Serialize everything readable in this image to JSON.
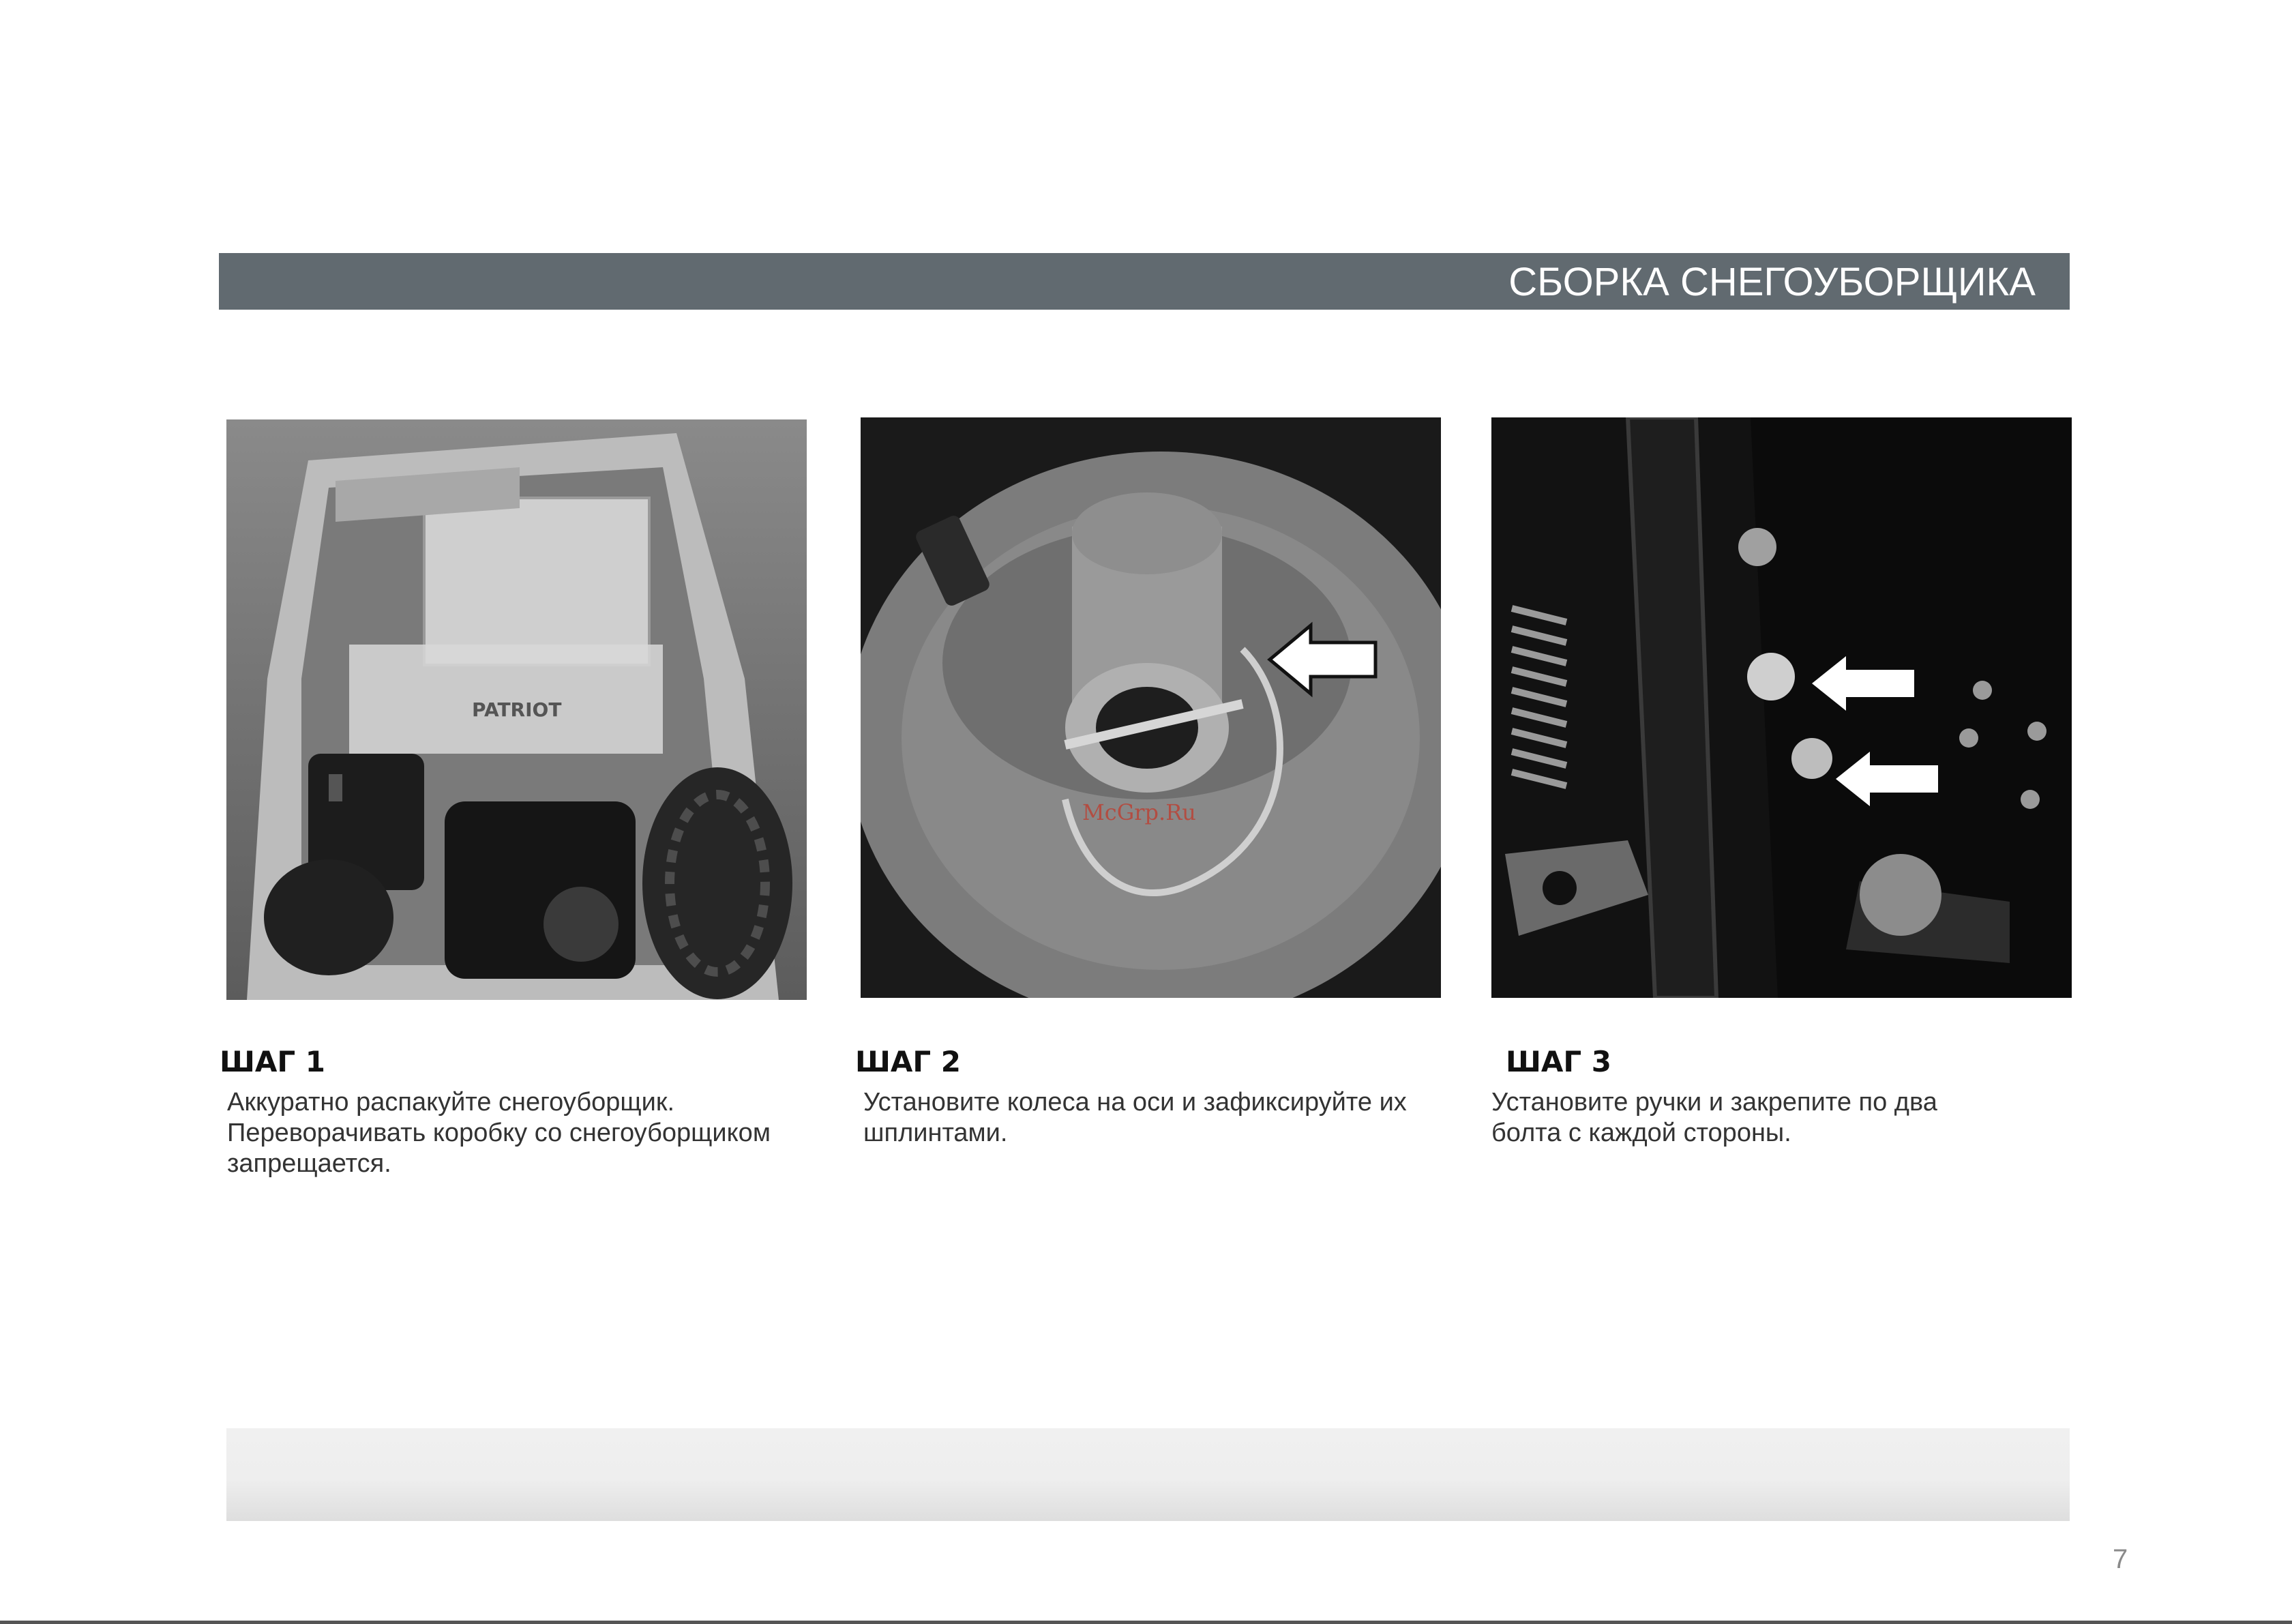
{
  "header": {
    "title": "СБОРКА СНЕГОУБОРЩИКА"
  },
  "steps": [
    {
      "title": "ШАГ 1",
      "lines": [
        "Аккуратно распакуйте снегоуборщик.",
        "Переворачивать коробку со снегоуборщиком",
        "запрещается."
      ],
      "photo_icon": "unpacking-box-photo"
    },
    {
      "title": "ШАГ 2",
      "lines": [
        "Установите колеса на оси и зафиксируйте их",
        "шплинтами."
      ],
      "photo_icon": "wheel-axle-pin-photo"
    },
    {
      "title": "ШАГ 3",
      "lines": [
        "Установите ручки и закрепите по два",
        "болта с каждой стороны."
      ],
      "photo_icon": "handle-bolts-photo"
    }
  ],
  "photos": {
    "watermark": "McGrp.Ru",
    "box_brand": "PATRIOT"
  },
  "colors": {
    "header_bar": "#616a70",
    "header_text": "#ffffff",
    "watermark": "#c0392b"
  },
  "footer": {
    "page_number": "7"
  }
}
